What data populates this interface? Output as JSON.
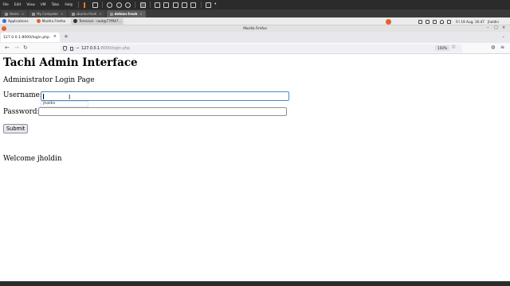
{
  "vm_menubar": {
    "menus": [
      "File",
      "Edit",
      "View",
      "VM",
      "Tabs",
      "Help"
    ]
  },
  "vm_tabs": [
    {
      "label": "Home",
      "active": false
    },
    {
      "label": "My Computer",
      "active": false
    },
    {
      "label": "ubuntu-fresh",
      "active": false
    },
    {
      "label": "debian-fresh",
      "active": true
    }
  ],
  "guest_panel": {
    "tasks": [
      {
        "label": "Applications",
        "dot": "#3d6fd6"
      },
      {
        "label": "Mozilla Firefox",
        "dot": "#e8602a"
      },
      {
        "label": "Terminal - root@77f947...",
        "dot": "#333333"
      }
    ],
    "clock": "Fri 19 Aug, 16:47",
    "user": "jholdin"
  },
  "window": {
    "title": "Mozilla Firefox"
  },
  "browser": {
    "tab_title": "127.0.0.1:8000/login.php",
    "url_host": "127.0.0.1",
    "url_path": ":8000/login.php",
    "zoom": "150%"
  },
  "page": {
    "title": "Tachi Admin Interface",
    "subtitle": "Administrator Login Page",
    "username_label": "Username:",
    "password_label": "Password:",
    "autocomplete_suggestion": "jholdin",
    "submit_label": "Submit",
    "welcome_text": "Welcome jholdin"
  },
  "colors": {
    "focus_ring": "#4a86c8",
    "firefox_orange": "#e8602a",
    "vm_accent": "#f07a1a"
  }
}
